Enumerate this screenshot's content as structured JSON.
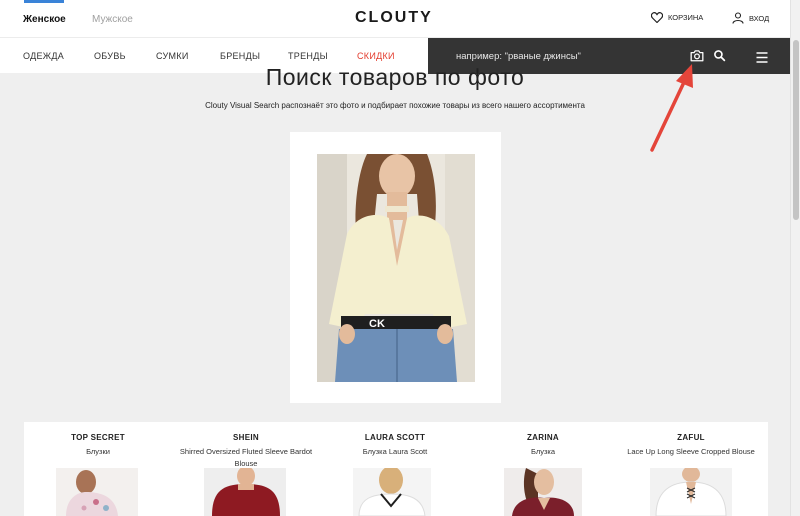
{
  "header": {
    "gender_women": "Женское",
    "gender_men": "Мужское",
    "logo": "CLOUTY",
    "cart_label": "КОРЗИНА",
    "login_label": "ВХОД"
  },
  "nav": {
    "items": [
      "ОДЕЖДА",
      "ОБУВЬ",
      "СУМКИ",
      "БРЕНДЫ",
      "ТРЕНДЫ",
      "СКИДКИ"
    ],
    "search_placeholder": "например: \"рваные джинсы\""
  },
  "main": {
    "title": "Поиск товаров по фото",
    "subtitle": "Clouty Visual Search распознаёт это фото и подбирает похожие товары из всего нашего ассортимента"
  },
  "results": [
    {
      "brand": "TOP SECRET",
      "desc": "Блузки"
    },
    {
      "brand": "SHEIN",
      "desc": "Shirred Oversized Fluted Sleeve Bardot Blouse"
    },
    {
      "brand": "LAURA SCOTT",
      "desc": "Блузка Laura Scott"
    },
    {
      "brand": "ZARINA",
      "desc": "Блузка"
    },
    {
      "brand": "ZAFUL",
      "desc": "Lace Up Long Sleeve Cropped Blouse"
    }
  ],
  "colors": {
    "accent_blue": "#3a83d8",
    "sale_red": "#e33b2d",
    "search_bg": "#343434",
    "arrow_red": "#e4453a"
  },
  "icons": [
    "heart-icon",
    "user-icon",
    "camera-icon",
    "search-icon",
    "menu-icon"
  ]
}
